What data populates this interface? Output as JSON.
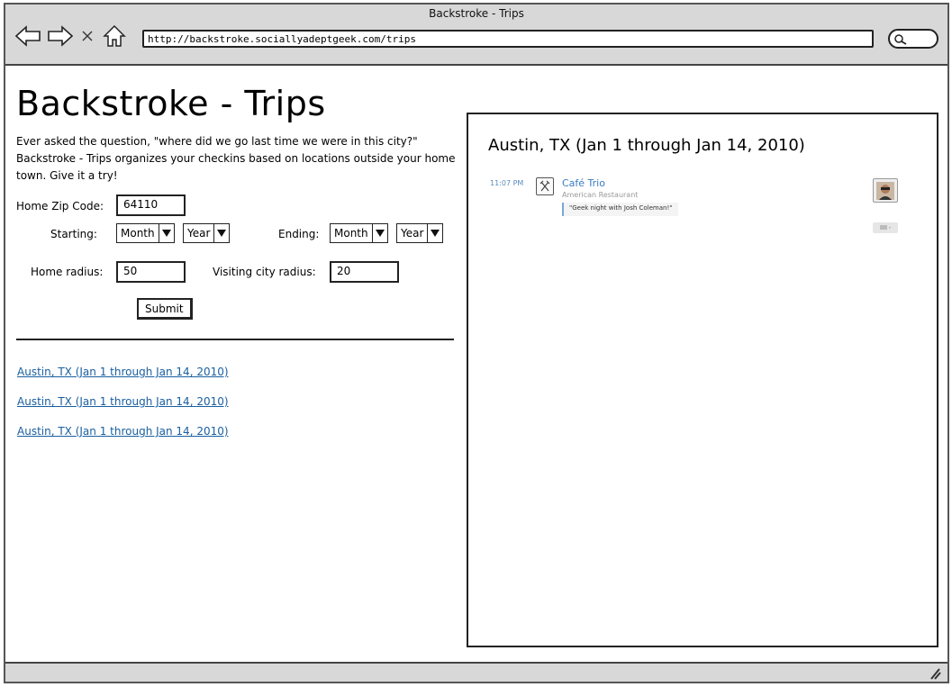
{
  "window": {
    "title": "Backstroke - Trips",
    "url": "http://backstroke.sociallyadeptgeek.com/trips"
  },
  "nav_icons": [
    "back-arrow-icon",
    "forward-arrow-icon",
    "stop-icon",
    "home-icon",
    "search-icon"
  ],
  "page": {
    "heading": "Backstroke - Trips",
    "intro_line1": "Ever asked the question, \"where did we go last time we were in this city?\"",
    "intro_line2": "Backstroke - Trips organizes your checkins based on locations outside your home",
    "intro_line3": "town. Give it a try!"
  },
  "form": {
    "zip_label": "Home Zip Code:",
    "zip_value": "64110",
    "starting_label": "Starting:",
    "ending_label": "Ending:",
    "month_option": "Month",
    "year_option": "Year",
    "home_radius_label": "Home radius:",
    "home_radius_value": "50",
    "visiting_radius_label": "Visiting city radius:",
    "visiting_radius_value": "20",
    "submit_label": "Submit"
  },
  "trips": [
    "Austin, TX (Jan 1 through Jan 14, 2010)",
    "Austin, TX (Jan 1 through Jan 14, 2010)",
    "Austin, TX (Jan 1 through Jan 14, 2010)"
  ],
  "detail": {
    "title": "Austin, TX (Jan 1 through Jan 14, 2010)",
    "checkin": {
      "time": "11:07 PM",
      "venue": "Café Trio",
      "category": "American Restaurant",
      "shout": "\"Geek night with Josh Coleman!\"",
      "venue_icon": "utensils-icon",
      "avatar": "user-avatar",
      "comment_icon": "comment-icon"
    }
  },
  "colors": {
    "link": "#1a5fa0",
    "chrome": "#d8d8d8",
    "checkin_name": "#3a7cc0"
  }
}
